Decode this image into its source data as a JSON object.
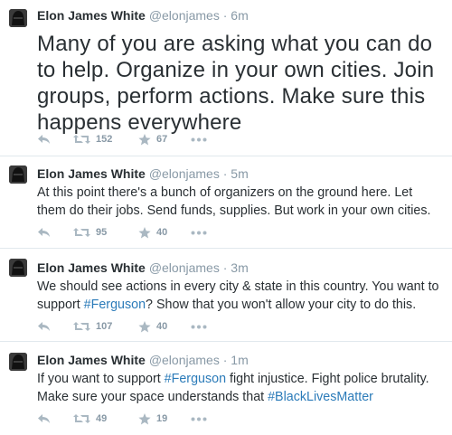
{
  "tweets": [
    {
      "name": "Elon James White",
      "handle": "@elonjames",
      "dot": "·",
      "time": "6m",
      "text": "Many of you are asking what you can do to help. Organize in your own cities. Join groups, perform actions. Make sure this happens everywhere",
      "retweets": "152",
      "favorites": "67"
    },
    {
      "name": "Elon James White",
      "handle": "@elonjames",
      "dot": "·",
      "time": "5m",
      "text": "At this point there's a bunch of organizers on the ground here. Let them do their jobs. Send funds, supplies. But work in your own cities.",
      "retweets": "95",
      "favorites": "40"
    },
    {
      "name": "Elon James White",
      "handle": "@elonjames",
      "dot": "·",
      "time": "3m",
      "text_pre": "We should see actions in every city & state in this country. You want to support ",
      "hashtag": "#Ferguson",
      "text_post": "? Show that you won't allow your city to do this.",
      "retweets": "107",
      "favorites": "40"
    },
    {
      "name": "Elon James White",
      "handle": "@elonjames",
      "dot": "·",
      "time": "1m",
      "text_pre": "If you want to support ",
      "hashtag1": "#Ferguson",
      "text_mid": " fight injustice. Fight police brutality. Make sure your space understands that ",
      "hashtag2": "#BlackLivesMatter",
      "retweets": "49",
      "favorites": "19"
    }
  ],
  "icons": [
    "reply-icon",
    "retweet-icon",
    "favorite-icon",
    "more-icon"
  ],
  "colors": {
    "text": "#292f33",
    "meta": "#8899a6",
    "hashtag": "#2b7bb9",
    "divider": "#e1e8ed"
  }
}
